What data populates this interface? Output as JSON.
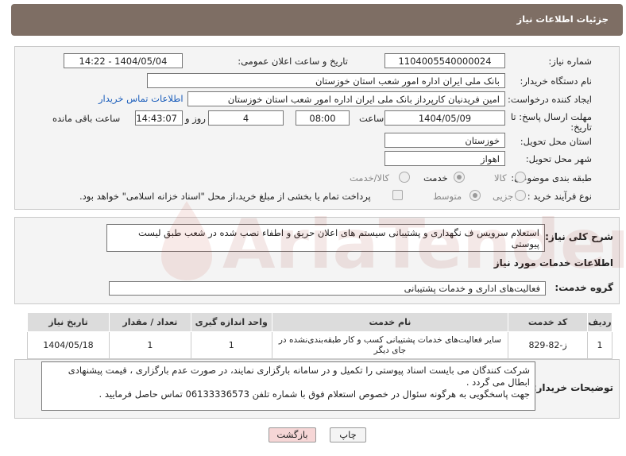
{
  "header": {
    "title": "جزئیات اطلاعات نیاز"
  },
  "form": {
    "need_number_label": "شماره نیاز:",
    "need_number": "1104005540000024",
    "announce_label": "تاریخ و ساعت اعلان عمومی:",
    "announce_value": "1404/05/04 - 14:22",
    "buyer_org_label": "نام دستگاه خریدار:",
    "buyer_org": "بانک ملی ایران اداره امور شعب استان خوزستان",
    "creator_label": "ایجاد کننده درخواست:",
    "creator": "امین  فریدنیان  کارپرداز بانک ملی ایران اداره امور شعب استان خوزستان",
    "contact_link": "اطلاعات تماس خریدار",
    "deadline_label_1": "مهلت ارسال پاسخ: تا",
    "deadline_label_2": "تاریخ:",
    "deadline_date": "1404/05/09",
    "time_label": "ساعت",
    "deadline_time": "08:00",
    "days_value": "4",
    "days_label": "روز و",
    "remaining_time": "14:43:07",
    "remaining_label": "ساعت باقی مانده",
    "province_label": "استان محل تحویل:",
    "province": "خوزستان",
    "city_label": "شهر محل تحویل:",
    "city": "اهواز",
    "category_label": "طبقه بندی موضوعی:",
    "category_options": [
      "کالا",
      "خدمت",
      "کالا/خدمت"
    ],
    "category_selected": "خدمت",
    "process_label": "نوع فرآیند خرید :",
    "process_options": [
      "جزیی",
      "متوسط"
    ],
    "process_selected": "متوسط",
    "payment_note": "پرداخت تمام یا بخشی از مبلغ خرید،از محل \"اسناد خزانه اسلامی\" خواهد بود."
  },
  "summary": {
    "label": "شرح کلی نیاز:",
    "text": "استعلام سرویس ف نگهداری و پشتیبانی سیستم های اعلان حریق و اطفاء نصب شده در شعب طبق لیست پیوستی"
  },
  "services": {
    "section_title": "اطلاعات خدمات مورد نیاز",
    "group_label": "گروه خدمت:",
    "group_value": "فعالیت‌های اداری و خدمات پشتیبانی",
    "columns": [
      "ردیف",
      "کد خدمت",
      "نام خدمت",
      "واحد اندازه گیری",
      "تعداد / مقدار",
      "تاریخ نیاز"
    ],
    "rows": [
      [
        "1",
        "ز-82-829",
        "سایر فعالیت‌های خدمات پشتیبانی کسب و کار طبقه‌بندی‌نشده در جای دیگر",
        "1",
        "1",
        "1404/05/18"
      ]
    ]
  },
  "buyer_notes": {
    "label": "توضیحات خریدار:",
    "line1": "شرکت کنندگان می بایست اسناد پیوستی را تکمیل و در سامانه بارگزاری نمایند، در صورت عدم بارگزاری ، قیمت پیشنهادی",
    "line2": "ابطال می گردد .",
    "line3": "جهت پاسخگویی به هرگونه سئوال در خصوص استعلام فوق با شماره تلفن 06133336573 تماس حاصل فرمایید ."
  },
  "buttons": {
    "print": "چاپ",
    "back": "بازگشت"
  },
  "watermark": {
    "text": "AriaTender.neT"
  },
  "colors": {
    "header": "#7e6e64",
    "link": "#1a5dbb",
    "back_button": "#f6d6d6"
  }
}
